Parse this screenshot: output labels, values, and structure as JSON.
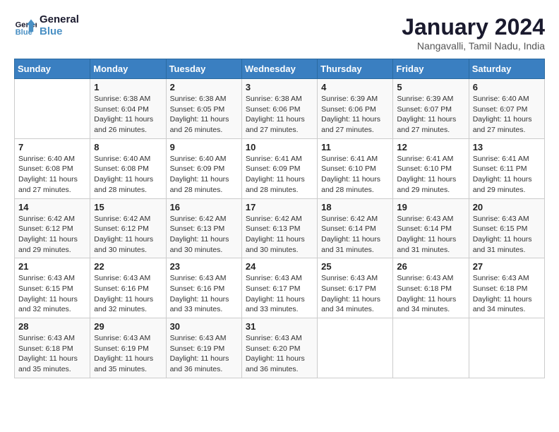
{
  "logo": {
    "line1": "General",
    "line2": "Blue"
  },
  "title": "January 2024",
  "subtitle": "Nangavalli, Tamil Nadu, India",
  "days_header": [
    "Sunday",
    "Monday",
    "Tuesday",
    "Wednesday",
    "Thursday",
    "Friday",
    "Saturday"
  ],
  "weeks": [
    [
      {
        "day": "",
        "info": ""
      },
      {
        "day": "1",
        "info": "Sunrise: 6:38 AM\nSunset: 6:04 PM\nDaylight: 11 hours\nand 26 minutes."
      },
      {
        "day": "2",
        "info": "Sunrise: 6:38 AM\nSunset: 6:05 PM\nDaylight: 11 hours\nand 26 minutes."
      },
      {
        "day": "3",
        "info": "Sunrise: 6:38 AM\nSunset: 6:06 PM\nDaylight: 11 hours\nand 27 minutes."
      },
      {
        "day": "4",
        "info": "Sunrise: 6:39 AM\nSunset: 6:06 PM\nDaylight: 11 hours\nand 27 minutes."
      },
      {
        "day": "5",
        "info": "Sunrise: 6:39 AM\nSunset: 6:07 PM\nDaylight: 11 hours\nand 27 minutes."
      },
      {
        "day": "6",
        "info": "Sunrise: 6:40 AM\nSunset: 6:07 PM\nDaylight: 11 hours\nand 27 minutes."
      }
    ],
    [
      {
        "day": "7",
        "info": "Sunrise: 6:40 AM\nSunset: 6:08 PM\nDaylight: 11 hours\nand 27 minutes."
      },
      {
        "day": "8",
        "info": "Sunrise: 6:40 AM\nSunset: 6:08 PM\nDaylight: 11 hours\nand 28 minutes."
      },
      {
        "day": "9",
        "info": "Sunrise: 6:40 AM\nSunset: 6:09 PM\nDaylight: 11 hours\nand 28 minutes."
      },
      {
        "day": "10",
        "info": "Sunrise: 6:41 AM\nSunset: 6:09 PM\nDaylight: 11 hours\nand 28 minutes."
      },
      {
        "day": "11",
        "info": "Sunrise: 6:41 AM\nSunset: 6:10 PM\nDaylight: 11 hours\nand 28 minutes."
      },
      {
        "day": "12",
        "info": "Sunrise: 6:41 AM\nSunset: 6:10 PM\nDaylight: 11 hours\nand 29 minutes."
      },
      {
        "day": "13",
        "info": "Sunrise: 6:41 AM\nSunset: 6:11 PM\nDaylight: 11 hours\nand 29 minutes."
      }
    ],
    [
      {
        "day": "14",
        "info": "Sunrise: 6:42 AM\nSunset: 6:12 PM\nDaylight: 11 hours\nand 29 minutes."
      },
      {
        "day": "15",
        "info": "Sunrise: 6:42 AM\nSunset: 6:12 PM\nDaylight: 11 hours\nand 30 minutes."
      },
      {
        "day": "16",
        "info": "Sunrise: 6:42 AM\nSunset: 6:13 PM\nDaylight: 11 hours\nand 30 minutes."
      },
      {
        "day": "17",
        "info": "Sunrise: 6:42 AM\nSunset: 6:13 PM\nDaylight: 11 hours\nand 30 minutes."
      },
      {
        "day": "18",
        "info": "Sunrise: 6:42 AM\nSunset: 6:14 PM\nDaylight: 11 hours\nand 31 minutes."
      },
      {
        "day": "19",
        "info": "Sunrise: 6:43 AM\nSunset: 6:14 PM\nDaylight: 11 hours\nand 31 minutes."
      },
      {
        "day": "20",
        "info": "Sunrise: 6:43 AM\nSunset: 6:15 PM\nDaylight: 11 hours\nand 31 minutes."
      }
    ],
    [
      {
        "day": "21",
        "info": "Sunrise: 6:43 AM\nSunset: 6:15 PM\nDaylight: 11 hours\nand 32 minutes."
      },
      {
        "day": "22",
        "info": "Sunrise: 6:43 AM\nSunset: 6:16 PM\nDaylight: 11 hours\nand 32 minutes."
      },
      {
        "day": "23",
        "info": "Sunrise: 6:43 AM\nSunset: 6:16 PM\nDaylight: 11 hours\nand 33 minutes."
      },
      {
        "day": "24",
        "info": "Sunrise: 6:43 AM\nSunset: 6:17 PM\nDaylight: 11 hours\nand 33 minutes."
      },
      {
        "day": "25",
        "info": "Sunrise: 6:43 AM\nSunset: 6:17 PM\nDaylight: 11 hours\nand 34 minutes."
      },
      {
        "day": "26",
        "info": "Sunrise: 6:43 AM\nSunset: 6:18 PM\nDaylight: 11 hours\nand 34 minutes."
      },
      {
        "day": "27",
        "info": "Sunrise: 6:43 AM\nSunset: 6:18 PM\nDaylight: 11 hours\nand 34 minutes."
      }
    ],
    [
      {
        "day": "28",
        "info": "Sunrise: 6:43 AM\nSunset: 6:18 PM\nDaylight: 11 hours\nand 35 minutes."
      },
      {
        "day": "29",
        "info": "Sunrise: 6:43 AM\nSunset: 6:19 PM\nDaylight: 11 hours\nand 35 minutes."
      },
      {
        "day": "30",
        "info": "Sunrise: 6:43 AM\nSunset: 6:19 PM\nDaylight: 11 hours\nand 36 minutes."
      },
      {
        "day": "31",
        "info": "Sunrise: 6:43 AM\nSunset: 6:20 PM\nDaylight: 11 hours\nand 36 minutes."
      },
      {
        "day": "",
        "info": ""
      },
      {
        "day": "",
        "info": ""
      },
      {
        "day": "",
        "info": ""
      }
    ]
  ]
}
